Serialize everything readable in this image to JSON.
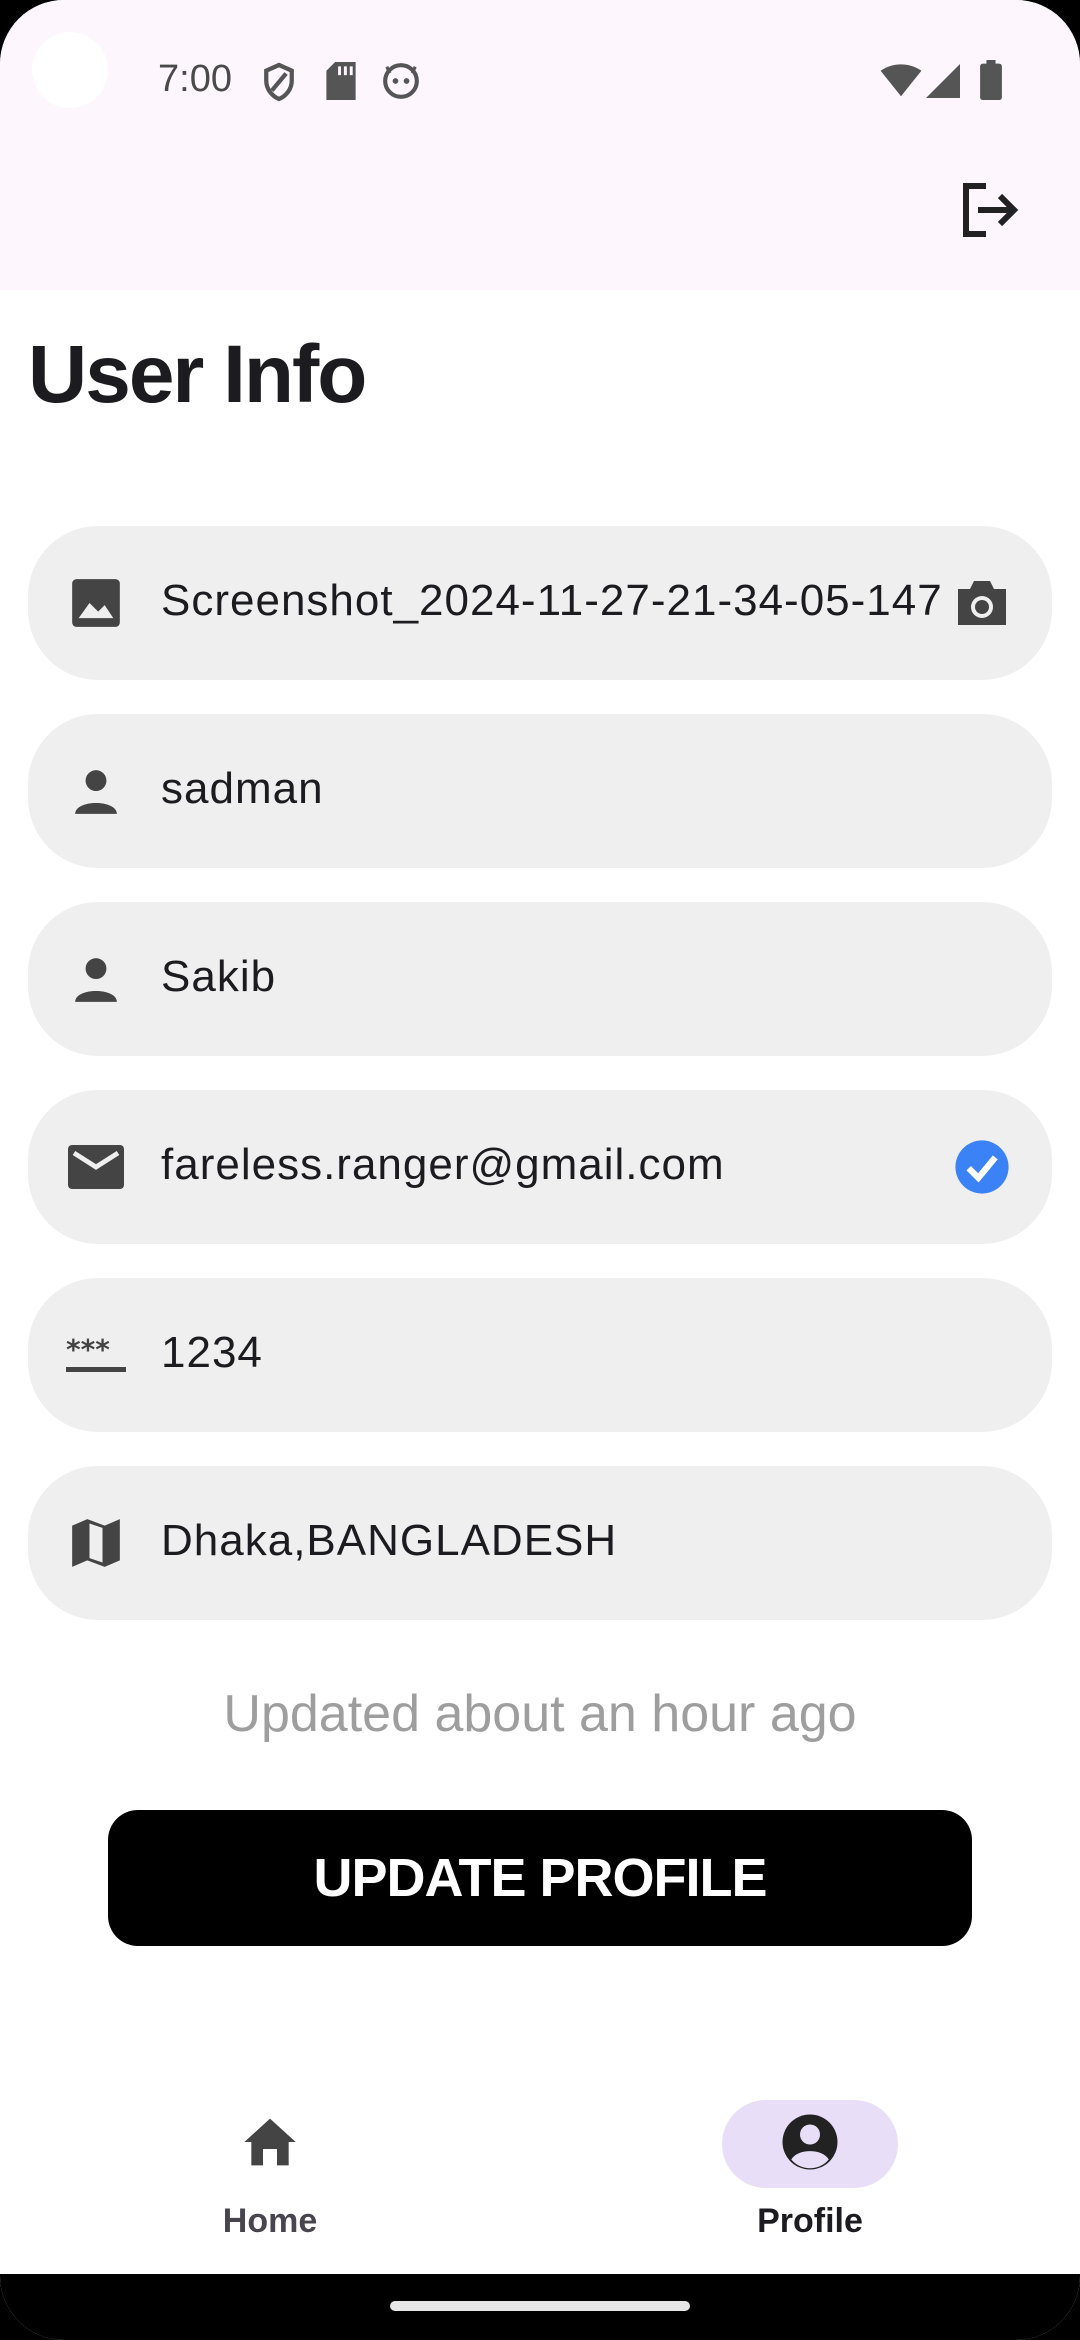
{
  "status_bar": {
    "time": "7:00",
    "left_icons": [
      "shield-icon",
      "sd-card-icon",
      "android-face-icon"
    ],
    "right_icons": [
      "wifi-icon",
      "cell-signal-icon",
      "battery-icon"
    ]
  },
  "app_bar": {
    "action_icon": "logout-icon"
  },
  "page": {
    "title": "User Info"
  },
  "fields": [
    {
      "icon": "image-icon",
      "value": "Screenshot_2024-11-27-21-34-05-147",
      "trailing_icon": "camera-icon"
    },
    {
      "icon": "person-icon",
      "value": "sadman"
    },
    {
      "icon": "person-icon",
      "value": "Sakib"
    },
    {
      "icon": "email-icon",
      "value": "fareless.ranger@gmail.com",
      "trailing_icon": "verified-check-icon"
    },
    {
      "icon": "password-icon",
      "value": "1234"
    },
    {
      "icon": "map-icon",
      "value": "Dhaka,BANGLADESH"
    }
  ],
  "updated_text": "Updated about an hour ago",
  "update_button_label": "UPDATE PROFILE",
  "bottom_nav": {
    "items": [
      {
        "label": "Home",
        "icon": "home-icon",
        "active": false
      },
      {
        "label": "Profile",
        "icon": "account-circle-icon",
        "active": true
      }
    ]
  },
  "colors": {
    "app_bar_bg": "#fdf6fd",
    "field_bg": "#efefef",
    "verified_blue": "#3b82f6",
    "nav_active_pill": "#e8def8",
    "button_bg": "#000000"
  }
}
